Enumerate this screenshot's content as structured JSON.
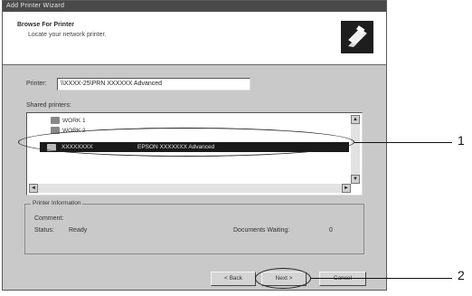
{
  "window": {
    "title": "Add Printer Wizard"
  },
  "header": {
    "title": "Browse For Printer",
    "subtitle": "Locate your network printer.",
    "icon": "printer-icon"
  },
  "printer_field": {
    "label": "Printer:",
    "value": "\\\\XXXX-25\\PRN XXXXXX Advanced"
  },
  "shared_printers": {
    "label": "Shared printers:",
    "items": [
      {
        "label": "WORK 1"
      },
      {
        "label": "WORK 2"
      }
    ],
    "selected": {
      "name": "XXXXXXXX",
      "description": "EPSON XXXXXXX Advanced"
    }
  },
  "printer_info": {
    "legend": "Printer Information",
    "comment_label": "Comment:",
    "status_label": "Status:",
    "status_value": "Ready",
    "docs_label": "Documents Waiting:",
    "docs_value": "0"
  },
  "buttons": {
    "back": "< Back",
    "next": "Next >",
    "cancel": "Cancel"
  },
  "callouts": {
    "one": "1",
    "two": "2"
  },
  "scroll": {
    "up": "▲",
    "down": "▼",
    "left": "◄",
    "right": "►"
  }
}
